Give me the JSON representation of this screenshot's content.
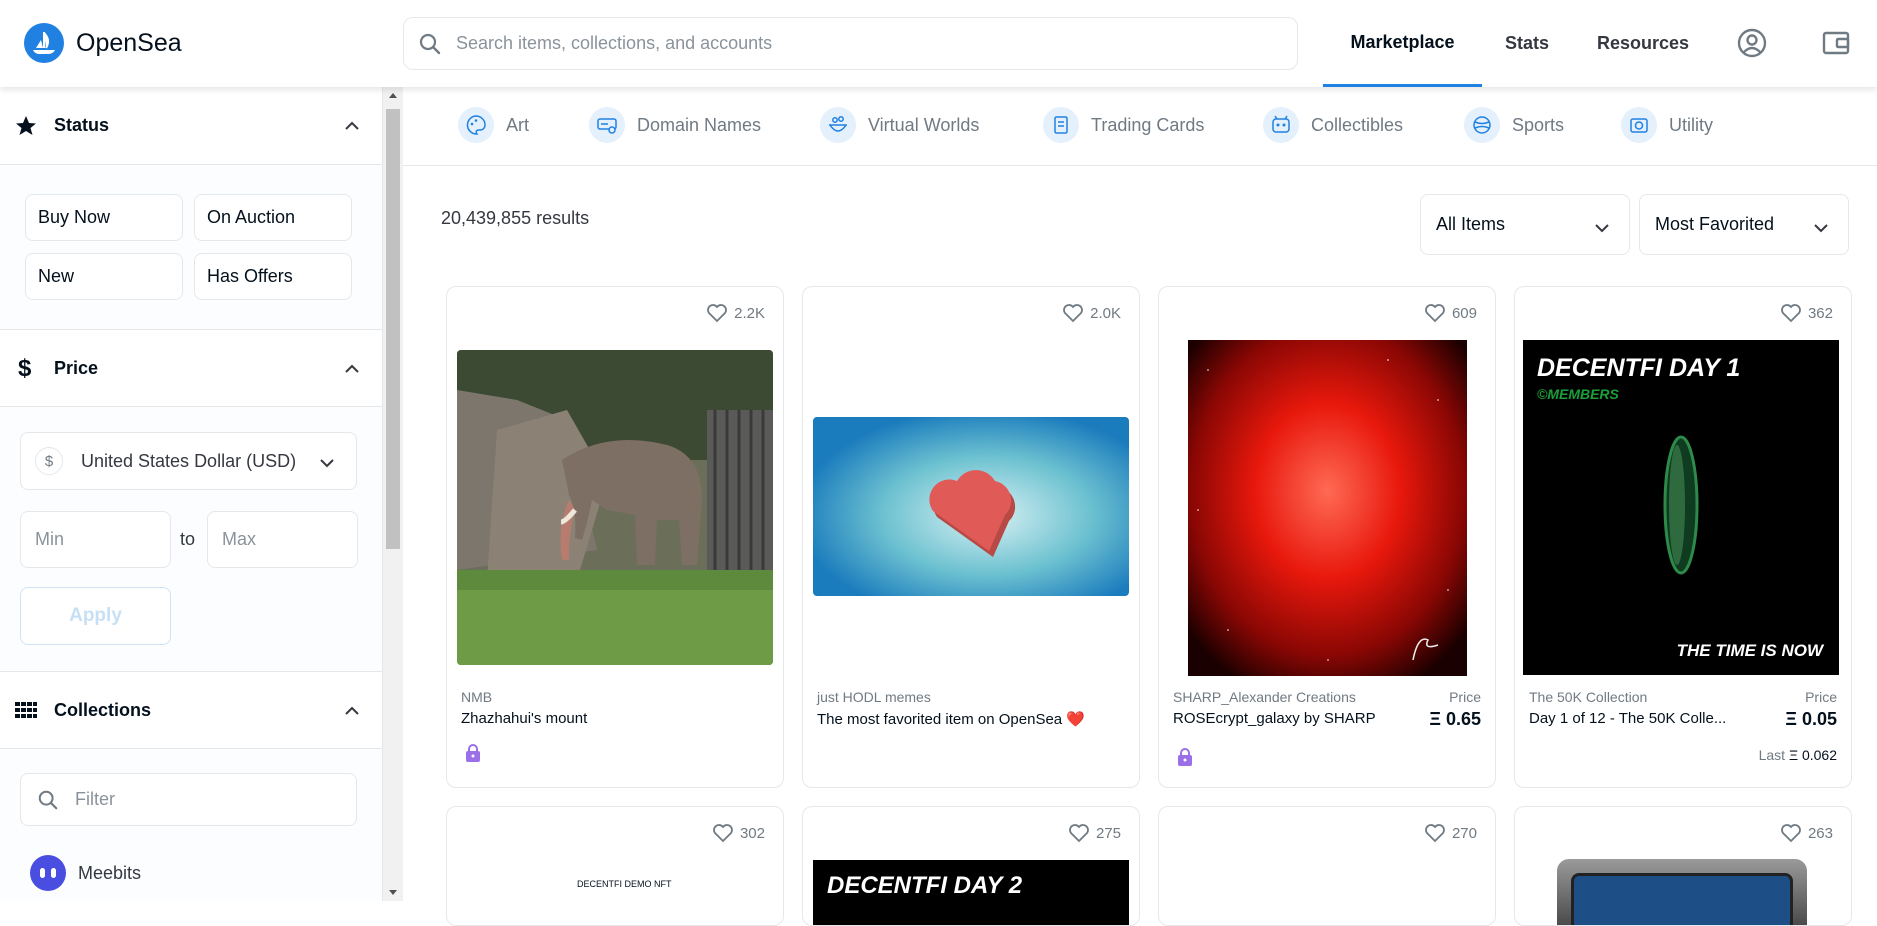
{
  "header": {
    "logo_text": "OpenSea",
    "search_placeholder": "Search items, collections, and accounts",
    "nav": [
      {
        "label": "Marketplace",
        "active": true
      },
      {
        "label": "Stats",
        "active": false
      },
      {
        "label": "Resources",
        "active": false
      }
    ],
    "accent_color": "#2081e2"
  },
  "sidebar": {
    "status": {
      "title": "Status",
      "buttons": [
        "Buy Now",
        "On Auction",
        "New",
        "Has Offers"
      ]
    },
    "price": {
      "title": "Price",
      "currency": "United States Dollar (USD)",
      "currency_symbol": "$",
      "min_placeholder": "Min",
      "to_label": "to",
      "max_placeholder": "Max",
      "apply_label": "Apply"
    },
    "collections": {
      "title": "Collections",
      "filter_placeholder": "Filter",
      "items": [
        {
          "label": "Meebits"
        }
      ]
    }
  },
  "categories": [
    "Art",
    "Domain Names",
    "Virtual Worlds",
    "Trading Cards",
    "Collectibles",
    "Sports",
    "Utility"
  ],
  "results": {
    "count_text": "20,439,855 results",
    "filter_dropdown": "All Items",
    "sort_dropdown": "Most Favorited"
  },
  "cards": [
    {
      "favorites": "2.2K",
      "collection": "NMB",
      "name": "Zhazhahui's mount",
      "locked": true
    },
    {
      "favorites": "2.0K",
      "collection": "just HODL memes",
      "name": "The most favorited item on OpenSea ❤️",
      "locked": false
    },
    {
      "favorites": "609",
      "collection": "SHARP_Alexander Creations",
      "name": "ROSEcrypt_galaxy by SHARP",
      "price_label": "Price",
      "price": "Ξ 0.65",
      "locked": true
    },
    {
      "favorites": "362",
      "collection": "The 50K Collection",
      "name": "Day 1 of 12 - The 50K Colle...",
      "price_label": "Price",
      "price": "Ξ 0.05",
      "last_label": "Last",
      "last_price": "Ξ 0.062",
      "thumb_title": "DECENTFI DAY 1",
      "thumb_sub": "©MEMBERS",
      "thumb_tagline": "THE TIME IS NOW"
    }
  ],
  "cards_row2": [
    {
      "favorites": "302",
      "thumb_text": "DECENTFI DEMO NFT"
    },
    {
      "favorites": "275",
      "thumb_text": "DECENTFI DAY 2"
    },
    {
      "favorites": "270"
    },
    {
      "favorites": "263"
    }
  ]
}
